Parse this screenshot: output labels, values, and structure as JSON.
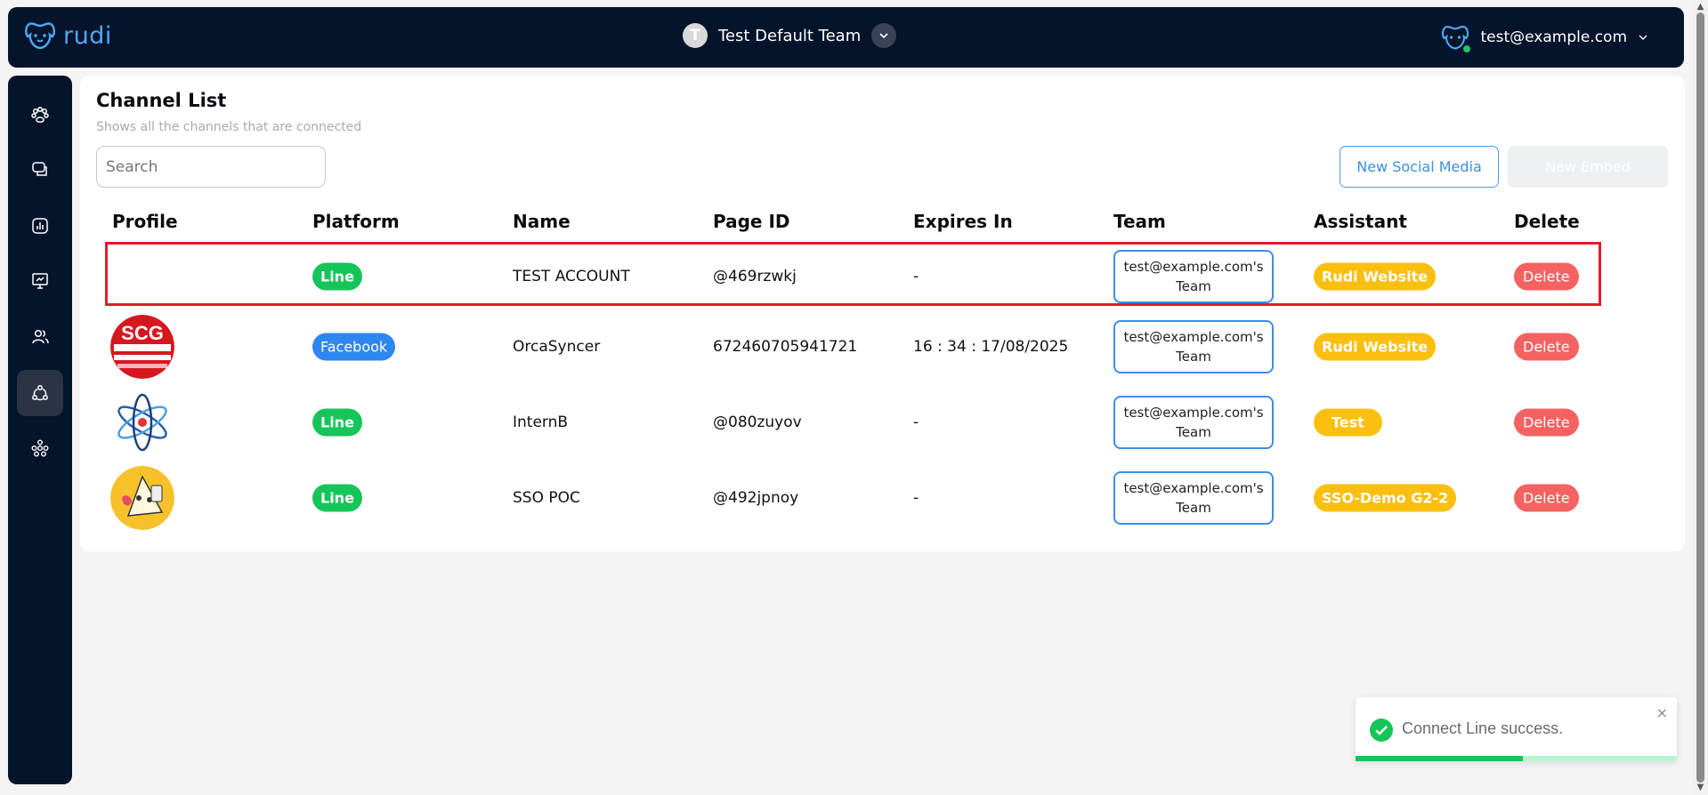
{
  "app": {
    "logo_text": "rudi",
    "brand_color": "#4ea8f5"
  },
  "header": {
    "team_initial": "T",
    "team_name": "Test Default Team",
    "user_email": "test@example.com"
  },
  "sidebar": {
    "items": [
      {
        "icon": "paw-icon"
      },
      {
        "icon": "chat-icon"
      },
      {
        "icon": "analytics-icon"
      },
      {
        "icon": "presentation-icon"
      },
      {
        "icon": "users-icon"
      },
      {
        "icon": "share-nodes-icon",
        "active": true
      },
      {
        "icon": "team-network-icon"
      }
    ]
  },
  "page": {
    "title": "Channel List",
    "subtitle": "Shows all the channels that are connected",
    "search_placeholder": "Search",
    "new_social_media_label": "New Social Media",
    "new_embed_label": "New Embed"
  },
  "table": {
    "headers": [
      "Profile",
      "Platform",
      "Name",
      "Page ID",
      "Expires In",
      "Team",
      "Assistant",
      "Delete"
    ],
    "rows": [
      {
        "profile": "",
        "platform": "Line",
        "name": "TEST ACCOUNT",
        "page_id": "@469rzwkj",
        "expires": "-",
        "team_line1": "test@example.com's",
        "team_line2": "Team",
        "assistant": "Rudi Website",
        "delete": "Delete"
      },
      {
        "profile": "scg-logo",
        "profile_text": "SCG",
        "platform": "Facebook",
        "name": "OrcaSyncer",
        "page_id": "672460705941721",
        "expires": "16 : 34 : 17/08/2025",
        "team_line1": "test@example.com's",
        "team_line2": "Team",
        "assistant": "Rudi Website",
        "delete": "Delete"
      },
      {
        "profile": "atom-logo",
        "platform": "Line",
        "name": "InternB",
        "page_id": "@080zuyov",
        "expires": "-",
        "team_line1": "test@example.com's",
        "team_line2": "Team",
        "assistant": "Test",
        "delete": "Delete"
      },
      {
        "profile": "cartoon-avatar",
        "platform": "Line",
        "name": "SSO POC",
        "page_id": "@492jpnoy",
        "expires": "-",
        "team_line1": "test@example.com's",
        "team_line2": "Team",
        "assistant": "SSO-Demo G2-2",
        "delete": "Delete"
      }
    ]
  },
  "toast": {
    "message": "Connect Line success.",
    "close": "×",
    "progress_percent": 52
  },
  "colors": {
    "line": "#16c55a",
    "facebook": "#2e86f0",
    "assistant": "#fbbf10",
    "delete": "#f56262",
    "navy": "#06142b",
    "highlight": "#e01e2a"
  }
}
